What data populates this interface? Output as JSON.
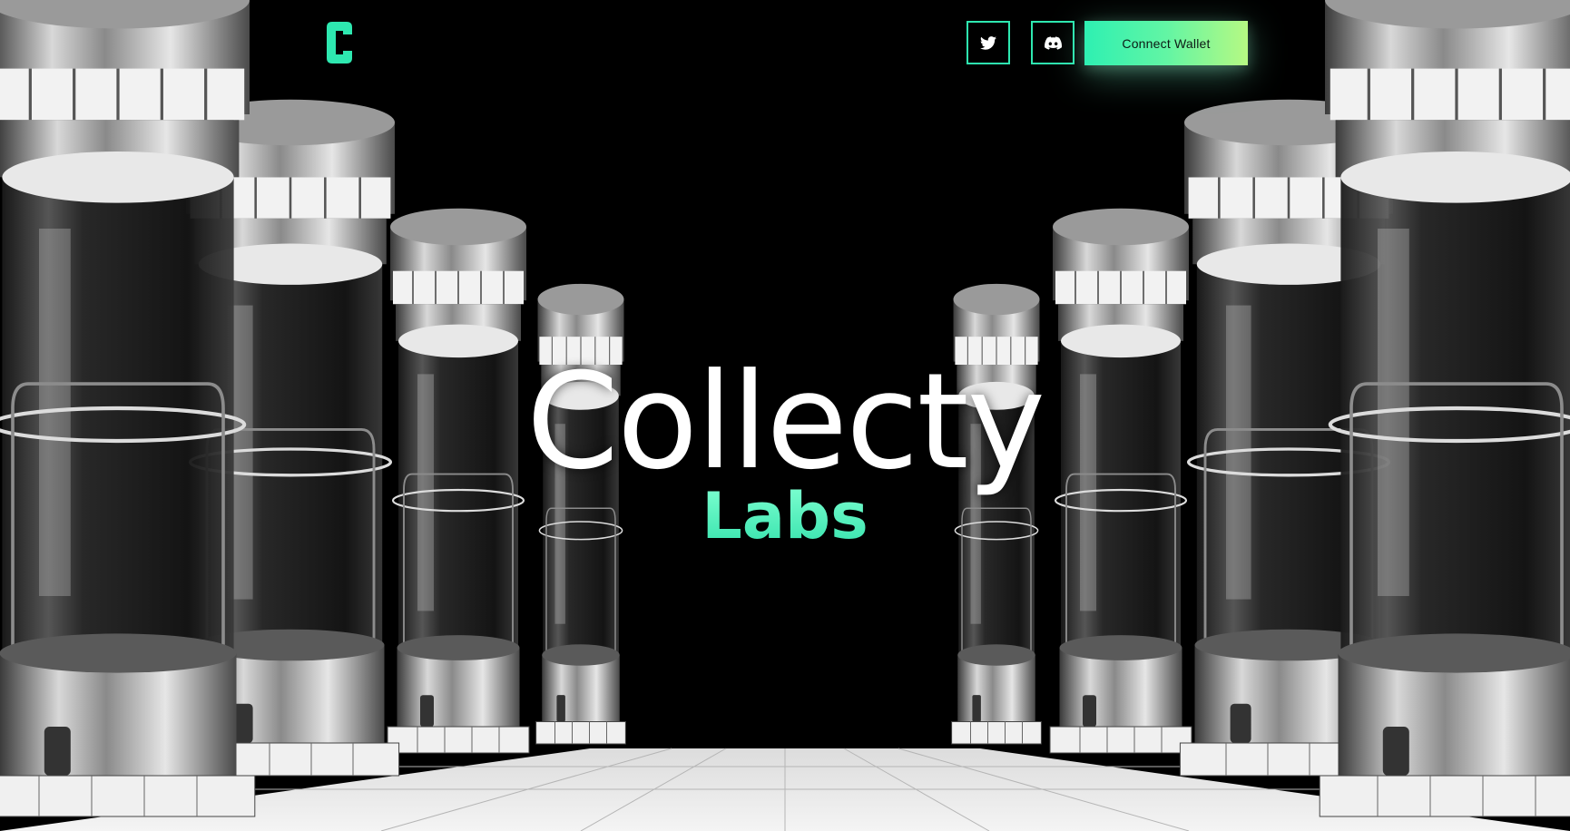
{
  "nav": {
    "logo_letter": "C",
    "twitter_icon": "twitter-icon",
    "discord_icon": "discord-icon",
    "connect_label": "Connect Wallet"
  },
  "hero": {
    "title": "Collecty",
    "subtitle": "Labs"
  },
  "colors": {
    "accent": "#2ee8b0",
    "accent_gradient_start": "#2ef0b2",
    "accent_gradient_end": "#b6f983",
    "background": "#000000"
  }
}
